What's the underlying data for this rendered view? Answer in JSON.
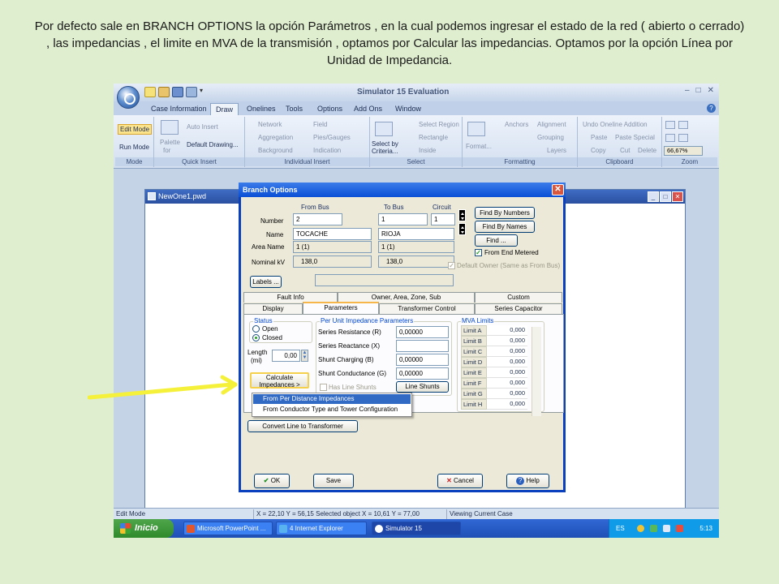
{
  "caption": "Por defecto sale  en BRANCH OPTIONS la opción Parámetros , en la cual podemos ingresar  el estado de la red ( abierto o cerrado)  , las impedancias , el limite en MVA de la transmisión , optamos por Calcular las impedancias. Optamos por la opción Línea por Unidad de Impedancia.",
  "app": {
    "title": "Simulator 15 Evaluation",
    "tabs": [
      "Case Information",
      "Draw",
      "Onelines",
      "Tools",
      "Options",
      "Add Ons",
      "Window"
    ],
    "active_tab": "Draw"
  },
  "ribbon": {
    "mode": {
      "edit": "Edit Mode",
      "run": "Run Mode",
      "label": "Mode"
    },
    "quick_insert": {
      "palette": "Palette",
      "palette_for": "for",
      "auto_insert": "Auto Insert",
      "default_drawing": "Default Drawing...",
      "label": "Quick Insert"
    },
    "individual_insert": {
      "network": "Network",
      "aggregation": "Aggregation",
      "background": "Background",
      "field": "Field",
      "pies_gauges": "Pies/Gauges",
      "indication": "Indication",
      "label": "Individual Insert"
    },
    "select": {
      "select_by": "Select by",
      "criteria": "Criteria...",
      "select_region": "Select Region",
      "rectangle": "Rectangle",
      "inside": "Inside",
      "label": "Select"
    },
    "formatting": {
      "format": "Format...",
      "anchors": "Anchors",
      "alignment": "Alignment",
      "grouping": "Grouping",
      "layers": "Layers",
      "label": "Formatting"
    },
    "clipboard": {
      "undo": "Undo Oneline Addition",
      "paste": "Paste",
      "paste_special": "Paste Special",
      "copy": "Copy",
      "cut": "Cut",
      "delete": "Delete",
      "label": "Clipboard"
    },
    "zoom": {
      "value": "66,67%",
      "label": "Zoom"
    }
  },
  "document": {
    "title": "NewOne1.pwd"
  },
  "dialog": {
    "title": "Branch Options",
    "headers": {
      "from_bus": "From Bus",
      "to_bus": "To Bus",
      "circuit": "Circuit"
    },
    "row_labels": {
      "number": "Number",
      "name": "Name",
      "area_name": "Area Name",
      "nominal_kv": "Nominal kV"
    },
    "from_bus": {
      "number": "2",
      "name": "TOCACHE",
      "area": "1 (1)",
      "kv": "138,0"
    },
    "to_bus": {
      "number": "1",
      "name": "RIOJA",
      "area": "1 (1)",
      "kv": "138,0"
    },
    "circuit": "1",
    "buttons": {
      "find_numbers": "Find By Numbers",
      "find_names": "Find By Names",
      "find": "Find ...",
      "labels": "Labels ..."
    },
    "from_end_metered": "From End Metered",
    "default_owner": "Default Owner (Same as From Bus)",
    "tabs_top": [
      "Fault Info",
      "Owner, Area, Zone, Sub",
      "Custom"
    ],
    "tabs_bottom": [
      "Display",
      "Parameters",
      "Transformer Control",
      "Series Capacitor"
    ],
    "status": {
      "title": "Status",
      "open": "Open",
      "closed": "Closed"
    },
    "length": {
      "label": "Length",
      "unit": "(mi)",
      "value": "0,00"
    },
    "calc_button": {
      "line1": "Calculate",
      "line2": "Impedances >"
    },
    "pu": {
      "title": "Per Unit Impedance Parameters",
      "fields": [
        {
          "label": "Series Resistance (R)",
          "value": "0,00000"
        },
        {
          "label": "Series Reactance (X)",
          "value": ""
        },
        {
          "label": "Shunt Charging (B)",
          "value": "0,00000"
        },
        {
          "label": "Shunt Conductance (G)",
          "value": "0,00000"
        }
      ],
      "has_line_shunts": "Has Line Shunts",
      "line_shunts_btn": "Line Shunts"
    },
    "mva": {
      "title": "MVA Limits",
      "limits": [
        {
          "label": "Limit A",
          "value": "0,000"
        },
        {
          "label": "Limit B",
          "value": "0,000"
        },
        {
          "label": "Limit C",
          "value": "0,000"
        },
        {
          "label": "Limit D",
          "value": "0,000"
        },
        {
          "label": "Limit E",
          "value": "0,000"
        },
        {
          "label": "Limit F",
          "value": "0,000"
        },
        {
          "label": "Limit G",
          "value": "0,000"
        },
        {
          "label": "Limit H",
          "value": "0,000"
        }
      ]
    },
    "menu": [
      "From Per Distance Impedances",
      "From Conductor Type and Tower Configuration"
    ],
    "convert_btn": "Convert Line to Transformer",
    "footer": {
      "ok": "OK",
      "save": "Save",
      "cancel": "Cancel",
      "help": "Help"
    }
  },
  "statusbar": {
    "mode": "Edit Mode",
    "coords": "X = 22,10 Y = 56,15 Selected object X = 10,61 Y = 77,00",
    "case": "Viewing Current Case"
  },
  "taskbar": {
    "start": "Inicio",
    "tasks": [
      "Microsoft PowerPoint ...",
      "4 Internet Explorer",
      "Simulator 15"
    ],
    "lang": "ES",
    "time": "5:13"
  },
  "colors": {
    "accent": "#0a4fd6",
    "arrow": "#f5f03a",
    "menu_highlight": "#316ac5"
  }
}
